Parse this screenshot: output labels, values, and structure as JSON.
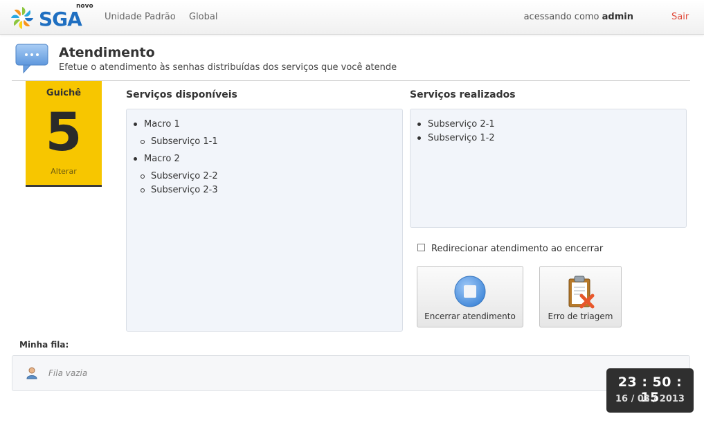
{
  "navbar": {
    "logo_prefix": "novo",
    "logo_text": "SGA",
    "unidade_label": "Unidade Padrão",
    "global_label": "Global",
    "user_prefix": "acessando como",
    "user_name": "admin",
    "logout_label": "Sair",
    "logout_color": "#e04a3a"
  },
  "header": {
    "icon": "speech-bubble-icon",
    "title": "Atendimento",
    "subtitle": "Efetue o atendimento às senhas distribuídas dos serviços que você atende"
  },
  "guiche": {
    "label": "Guichê",
    "number": "5",
    "change_label": "Alterar",
    "color": "#f7c600"
  },
  "servicos_disponiveis": {
    "title": "Serviços disponíveis",
    "macros": [
      {
        "label": "Macro 1",
        "subs": [
          "Subserviço 1-1"
        ]
      },
      {
        "label": "Macro 2",
        "subs": [
          "Subserviço 2-2",
          "Subserviço 2-3"
        ]
      }
    ]
  },
  "servicos_realizados": {
    "title": "Serviços realizados",
    "items": [
      "Subserviço 2-1",
      "Subserviço 1-2"
    ]
  },
  "redirect": {
    "label": "Redirecionar atendimento ao encerrar",
    "checked": false
  },
  "actions": {
    "encerrar_label": "Encerrar atendimento",
    "encerrar_icon": "stop-icon",
    "erro_label": "Erro de triagem",
    "erro_icon": "clipboard-error-icon"
  },
  "fila": {
    "title": "Minha fila:",
    "empty_text": "Fila vazia",
    "icon": "user-icon"
  },
  "clock": {
    "time": "23 : 50 : 15",
    "date": "16 / 03 / 2013"
  }
}
